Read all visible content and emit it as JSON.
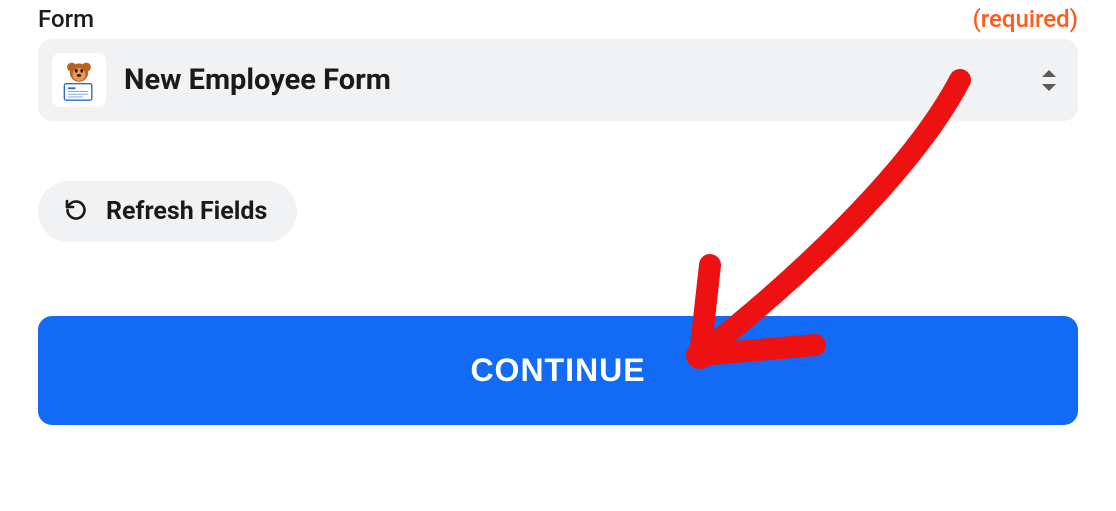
{
  "form_field": {
    "label": "Form",
    "required_text": "(required)",
    "selected_value": "New Employee Form",
    "app_icon": "wpforms-icon"
  },
  "refresh_button": {
    "label": "Refresh Fields"
  },
  "continue_button": {
    "label": "CONTINUE"
  },
  "annotation": {
    "color": "#ee1111",
    "target": "continue-button"
  }
}
